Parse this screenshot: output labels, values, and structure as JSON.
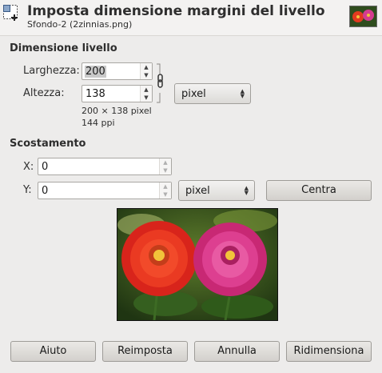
{
  "header": {
    "title": "Imposta dimensione margini del livello",
    "subtitle": "Sfondo-2 (2zinnias.png)"
  },
  "dimension": {
    "section_title": "Dimensione livello",
    "width_label": "Larghezza:",
    "width_value": "200",
    "height_label": "Altezza:",
    "height_value": "138",
    "unit": "pixel",
    "size_info": "200 × 138 pixel",
    "resolution_info": "144 ppi",
    "chain_linked": true
  },
  "offset": {
    "section_title": "Scostamento",
    "x_label": "X:",
    "x_value": "0",
    "y_label": "Y:",
    "y_value": "0",
    "unit": "pixel",
    "center_label": "Centra"
  },
  "buttons": {
    "help": "Aiuto",
    "reset": "Reimposta",
    "cancel": "Annulla",
    "resize": "Ridimensiona"
  },
  "icons": {
    "header": "layer-boundary-size-icon",
    "chain": "chain-link-icon",
    "spin_up": "arrow-up-icon",
    "spin_down": "arrow-down-icon",
    "combo": "updown-arrows-icon"
  },
  "colors": {
    "background": "#edeceb",
    "selection": "#c9c9c9"
  }
}
